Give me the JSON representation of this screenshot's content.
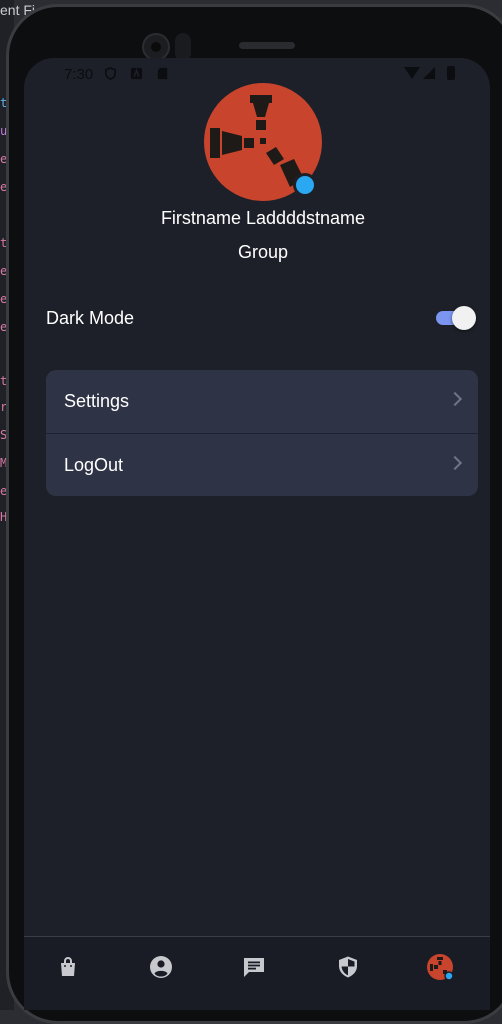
{
  "window": {
    "title_fragment": "ent Fi"
  },
  "editor": {
    "code_chars": [
      "t",
      "u",
      "e",
      "e",
      "t",
      "e",
      "e",
      "e",
      "t",
      "r",
      "S",
      "M",
      "e",
      "H"
    ]
  },
  "status_bar": {
    "time": "7:30",
    "icons": [
      "shield-icon",
      "font-icon",
      "sdcard-icon",
      "wifi-icon",
      "signal-icon",
      "battery-icon"
    ]
  },
  "profile": {
    "name": "Firstname Laddddstname",
    "group": "Group",
    "avatar_color": "#c8442c",
    "online_color": "#2aa8f2"
  },
  "settings": {
    "dark_mode": {
      "label": "Dark Mode",
      "enabled": true
    }
  },
  "menu": {
    "items": [
      {
        "label": "Settings",
        "icon": "chevron-right-icon"
      },
      {
        "label": "LogOut",
        "icon": "chevron-right-icon"
      }
    ]
  },
  "bottom_nav": {
    "items": [
      {
        "icon": "shopping-bag-icon"
      },
      {
        "icon": "account-circle-icon"
      },
      {
        "icon": "chat-icon"
      },
      {
        "icon": "shield-icon"
      },
      {
        "icon": "profile-avatar-icon",
        "active": true
      }
    ]
  },
  "colors": {
    "screen_bg": "#1d2029",
    "card_bg": "#2e3346",
    "toggle_track": "#7b95f0",
    "accent_red": "#c8442c"
  }
}
